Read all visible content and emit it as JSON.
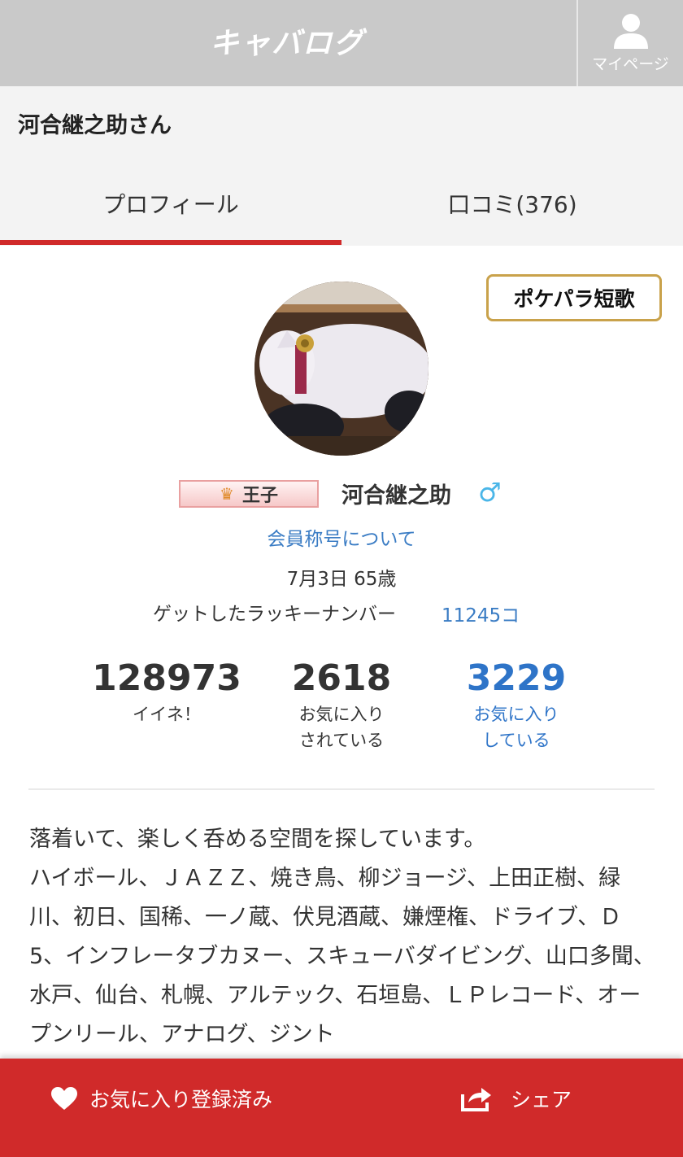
{
  "header": {
    "logo": "キャバログ",
    "mypage_label": "マイページ"
  },
  "page": {
    "title": "河合継之助さん"
  },
  "tabs": [
    {
      "label": "プロフィール",
      "active": true
    },
    {
      "label": "口コミ(376)",
      "active": false
    }
  ],
  "badge": {
    "label": "ポケパラ短歌"
  },
  "profile": {
    "rank_label": "王子",
    "username": "河合継之助",
    "gender_symbol": "♂",
    "about_link": "会員称号について",
    "birth_age": "7月3日 65歳",
    "lucky_label": "ゲットしたラッキーナンバー",
    "lucky_value": "11245コ"
  },
  "stats": [
    {
      "value": "128973",
      "label_line1": "イイネ！",
      "label_line2": ""
    },
    {
      "value": "2618",
      "label_line1": "お気に入り",
      "label_line2": "されている"
    },
    {
      "value": "3229",
      "label_line1": "お気に入り",
      "label_line2": "している"
    }
  ],
  "bio": "落着いて、楽しく呑める空間を探しています。\nハイボール、ＪＡＺＺ、焼き鳥、柳ジョージ、上田正樹、緑川、初日、国稀、一ノ蔵、伏見酒蔵、嫌煙権、ドライブ、Ｄ5、インフレータブカヌー、スキューバダイビング、山口多聞、水戸、仙台、札幌、アルテック、石垣島、ＬＰレコード、オープンリール、アナログ、ジント",
  "bottom_bar": {
    "favorite_label": "お気に入り登録済み",
    "share_label": "シェア"
  },
  "colors": {
    "accent_red": "#d02a2a",
    "link_blue": "#3a7cc4",
    "header_gray": "#c9c9c9"
  }
}
